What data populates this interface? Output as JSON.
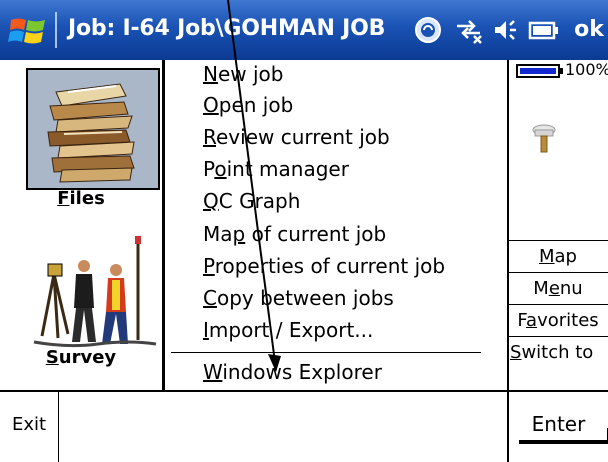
{
  "titlebar": {
    "title": "Job: I-64 Job\\GOHMAN JOB",
    "ok_label": "ok",
    "icons": [
      "windows-start-icon",
      "sync-icon",
      "connectivity-icon",
      "volume-icon",
      "battery-icon"
    ]
  },
  "left_panel": {
    "files": {
      "label": "Files",
      "hotkey_letter": "F",
      "icon": "files-stack-icon"
    },
    "survey": {
      "label": "Survey",
      "hotkey_letter": "S",
      "icon": "surveyors-icon"
    }
  },
  "menu": {
    "items": [
      {
        "pre": "",
        "hot": "N",
        "post": "ew job"
      },
      {
        "pre": "",
        "hot": "O",
        "post": "pen job"
      },
      {
        "pre": "",
        "hot": "R",
        "post": "eview current job"
      },
      {
        "pre": "P",
        "hot": "o",
        "post": "int manager"
      },
      {
        "pre": "",
        "hot": "Q",
        "post": "C Graph"
      },
      {
        "pre": "Ma",
        "hot": "p",
        "post": " of current job"
      },
      {
        "pre": "",
        "hot": "P",
        "post": "roperties of current job"
      },
      {
        "pre": "",
        "hot": "C",
        "post": "opy between jobs"
      },
      {
        "pre": "",
        "hot": "I",
        "post": "mport / Export..."
      },
      {
        "pre": "",
        "hot": "W",
        "post": "indows Explorer"
      }
    ]
  },
  "right_panel": {
    "battery_percent": "100%",
    "battery_level": 1.0,
    "buttons": [
      {
        "pre": "",
        "hot": "M",
        "post": "ap"
      },
      {
        "pre": "M",
        "hot": "e",
        "post": "nu"
      },
      {
        "pre": "F",
        "hot": "a",
        "post": "vorites"
      },
      {
        "pre": "",
        "hot": "S",
        "post": "witch to"
      }
    ]
  },
  "bottombar": {
    "exit_label": "Exit",
    "enter_label": "Enter"
  },
  "colors": {
    "titlebar": "#1a52b4",
    "battery_fill": "#1428d0",
    "files_tile": "#a9b7c9"
  }
}
